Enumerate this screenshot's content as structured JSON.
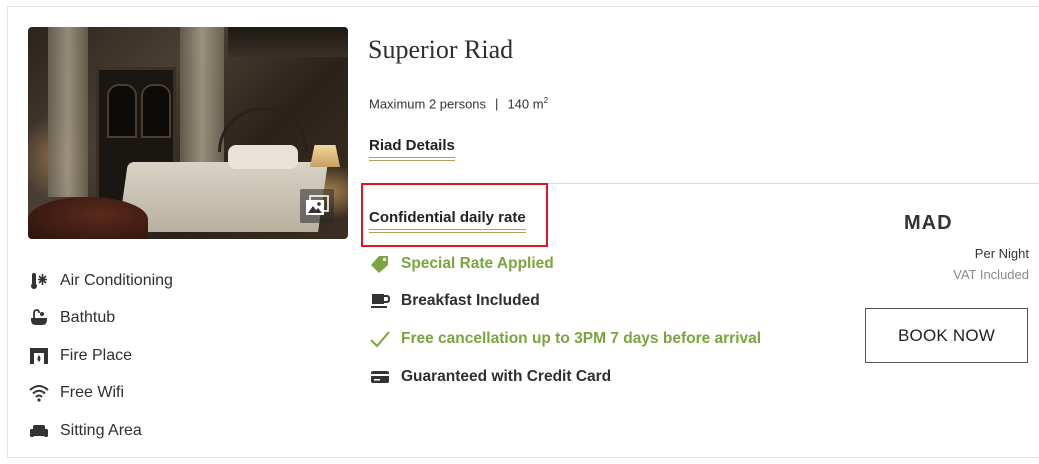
{
  "room": {
    "title": "Superior Riad",
    "capacity": "Maximum 2 persons",
    "separator": "|",
    "size_value": "140 m",
    "size_sup": "2",
    "details_link": "Riad Details",
    "photo_alt": "Superior Riad bedroom"
  },
  "amenities": [
    {
      "icon": "air-conditioning-icon",
      "label": "Air Conditioning"
    },
    {
      "icon": "bathtub-icon",
      "label": "Bathtub"
    },
    {
      "icon": "fireplace-icon",
      "label": "Fire Place"
    },
    {
      "icon": "wifi-icon",
      "label": "Free Wifi"
    },
    {
      "icon": "sofa-icon",
      "label": "Sitting Area"
    }
  ],
  "rate": {
    "name": "Confidential daily rate",
    "perks": [
      {
        "icon": "tag-icon",
        "text": "Special Rate Applied",
        "style": "green"
      },
      {
        "icon": "coffee-cup-icon",
        "text": "Breakfast Included",
        "style": "dark"
      },
      {
        "icon": "checkmark-icon",
        "text": "Free cancellation up to 3PM 7 days before arrival",
        "style": "green"
      },
      {
        "icon": "credit-card-icon",
        "text": "Guaranteed with Credit Card",
        "style": "dark"
      }
    ]
  },
  "price": {
    "currency": "MAD",
    "per_night": "Per Night",
    "vat": "VAT Included",
    "book_label": "BOOK NOW"
  },
  "colors": {
    "accent_gold": "#b59e5a",
    "perk_green": "#7aa53e",
    "highlight_red": "#e5141e"
  }
}
